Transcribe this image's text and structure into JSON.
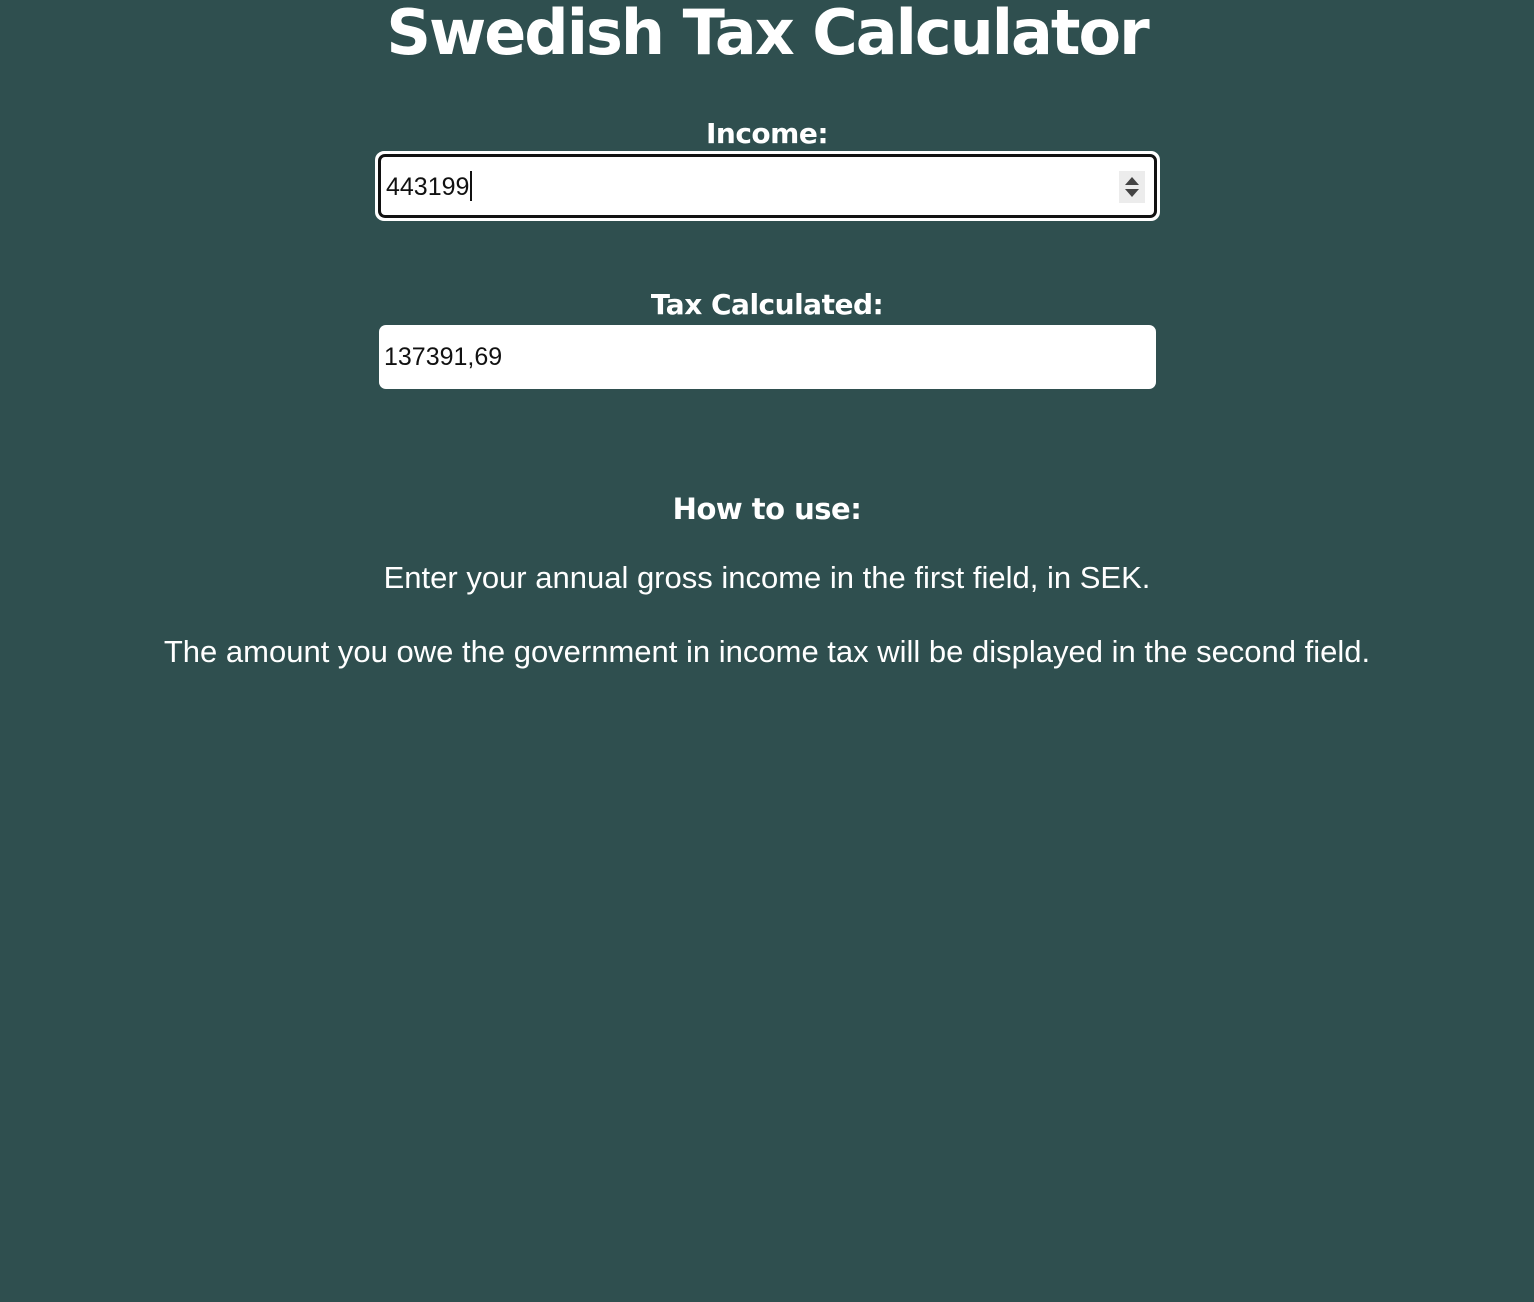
{
  "page": {
    "title": "Swedish Tax Calculator",
    "background_color": "#2f4f4f"
  },
  "income": {
    "label": "Income:",
    "value": "443199"
  },
  "tax": {
    "label": "Tax Calculated:",
    "value": "137391,69"
  },
  "how_to_use": {
    "heading": "How to use:",
    "line1": "Enter your annual gross income in the first field, in SEK.",
    "line2": "The amount you owe the government in income tax will be displayed in the second field."
  },
  "icons": {
    "spinner_up": "chevron-up-icon",
    "spinner_down": "chevron-down-icon"
  }
}
